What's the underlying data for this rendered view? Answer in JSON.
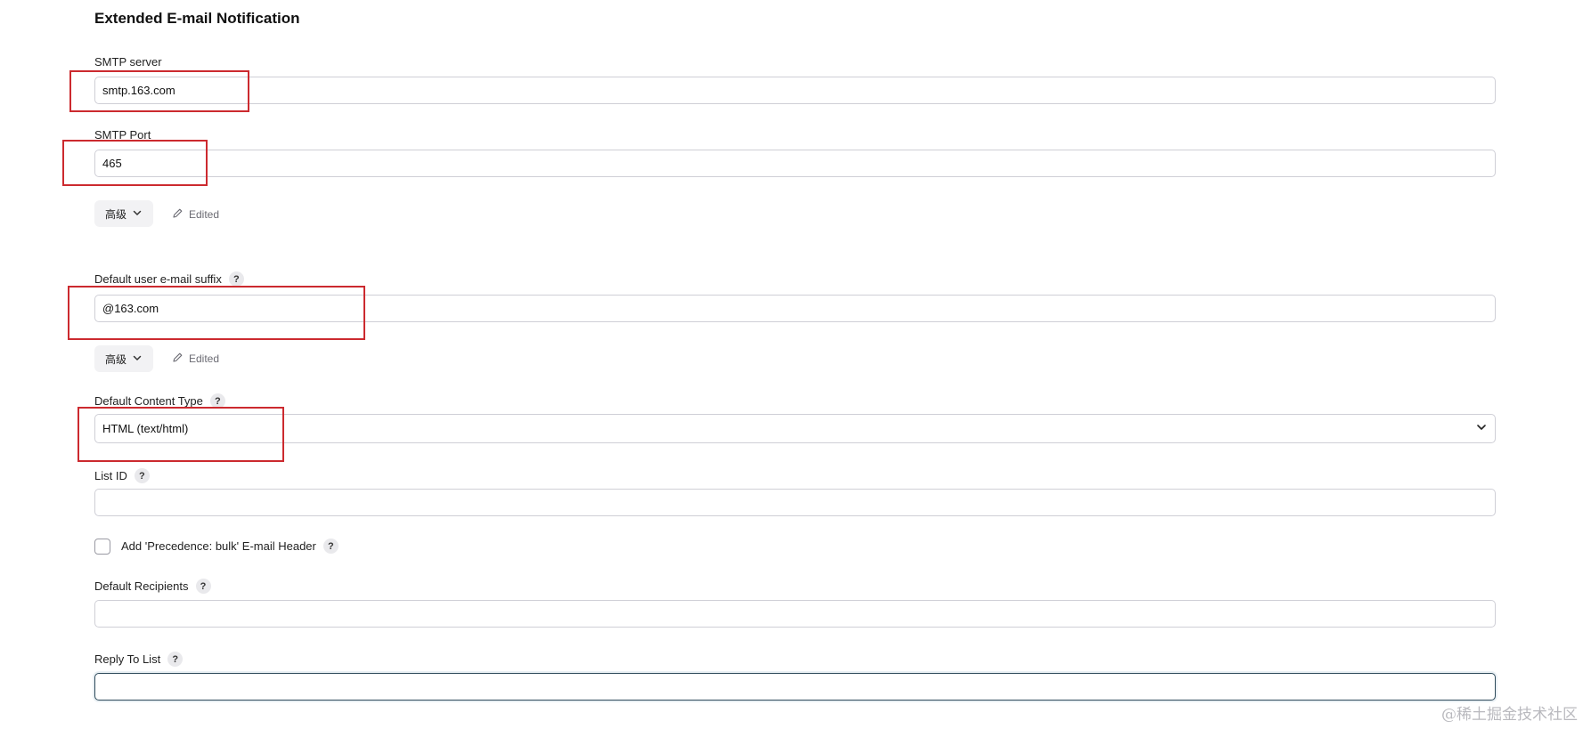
{
  "section": {
    "title": "Extended E-mail Notification"
  },
  "smtp_server": {
    "label": "SMTP server",
    "value": "smtp.163.com"
  },
  "smtp_port": {
    "label": "SMTP Port",
    "value": "465"
  },
  "advanced_1": {
    "label": "高级",
    "edited": "Edited"
  },
  "default_suffix": {
    "label": "Default user e-mail suffix",
    "value": "@163.com"
  },
  "advanced_2": {
    "label": "高级",
    "edited": "Edited"
  },
  "content_type": {
    "label": "Default Content Type",
    "selected": "HTML (text/html)"
  },
  "list_id": {
    "label": "List ID",
    "value": ""
  },
  "precedence": {
    "label": "Add 'Precedence: bulk' E-mail Header",
    "checked": false
  },
  "default_recipients": {
    "label": "Default Recipients",
    "value": ""
  },
  "reply_to": {
    "label": "Reply To List",
    "value": ""
  },
  "help": {
    "glyph": "?"
  },
  "watermark": {
    "text": "@稀土掘金技术社区"
  },
  "colors": {
    "annotation": "#cc2a2f",
    "focus_border": "#2d4a5a",
    "input_border": "#cfcfd6"
  },
  "icons": {
    "dropdown": "chevron-down-icon",
    "edited": "pencil-icon",
    "help": "help-icon"
  }
}
